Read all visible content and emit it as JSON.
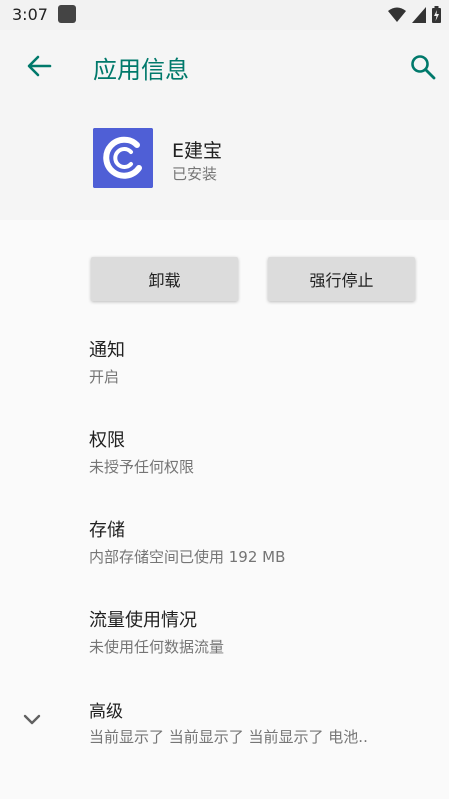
{
  "status_bar": {
    "time": "3:07"
  },
  "toolbar": {
    "title": "应用信息"
  },
  "app": {
    "name": "E建宝",
    "status": "已安装",
    "icon_color": "#4f5fd6"
  },
  "buttons": {
    "uninstall": "卸载",
    "force_stop": "强行停止"
  },
  "settings": [
    {
      "title": "通知",
      "subtitle": "开启"
    },
    {
      "title": "权限",
      "subtitle": "未授予任何权限"
    },
    {
      "title": "存储",
      "subtitle": "内部存储空间已使用 192 MB"
    },
    {
      "title": "流量使用情况",
      "subtitle": "未使用任何数据流量"
    },
    {
      "title": "高级",
      "subtitle": "当前显示了 当前显示了 当前显示了 电池.."
    }
  ],
  "colors": {
    "accent": "#00796b",
    "background": "#fafafa",
    "header_bg": "#f5f5f5"
  }
}
